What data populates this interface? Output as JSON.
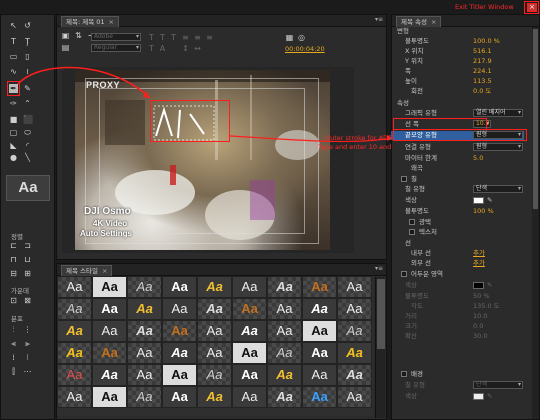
{
  "title_panel_tab": "제목: 제목 01",
  "title_props_tab": "제목 속성",
  "styles_tab": "제목 스타일",
  "annotation_close": "Exit Titler Window",
  "annotation_stroke_1": "Outer stroke for ADD",
  "annotation_stroke_2": "Type and enter 10 and choose Round",
  "toolbar": {
    "font_family": "Adobe",
    "font_style": "Regular",
    "timecode": "00:00:04:20"
  },
  "canvas": {
    "proxy_label": "PROXY",
    "overlay_line1": "DJI Osmo",
    "overlay_line2": "4K Video",
    "overlay_line3": "Auto Settings"
  },
  "props": {
    "transform_header": "변형",
    "opacity_label": "불투명도",
    "opacity_value": "100.0 %",
    "xpos_label": "X 위치",
    "xpos_value": "516.1",
    "ypos_label": "Y 위치",
    "ypos_value": "217.9",
    "width_label": "폭",
    "width_value": "224.1",
    "height_label": "높이",
    "height_value": "113.5",
    "rotation_label": "회전",
    "rotation_value": "0.0 도",
    "properties_header": "속성",
    "graphic_type_label": "그래픽 유형",
    "graphic_type_value": "열린 베지어",
    "line_width_label": "선 폭",
    "line_width_value": "10.0",
    "cap_type_label": "끝모양 유형",
    "cap_type_value": "원형",
    "join_type_label": "연결 유형",
    "join_type_value": "원형",
    "miter_label": "마이터 한계",
    "miter_value": "5.0",
    "distort_label": "왜곡",
    "fill_header": "칠",
    "fill_type_label": "칠 유형",
    "fill_type_value": "단색",
    "color_label": "색상",
    "fill_opacity_label": "불투명도",
    "fill_opacity_value": "100 %",
    "sheen_label": "광택",
    "texture_label": "텍스처",
    "stroke_header": "선",
    "inner_stroke_label": "내부 선",
    "inner_stroke_add": "추가",
    "outer_stroke_label": "외부 선",
    "outer_stroke_add": "추가",
    "shadow_header": "어두운 영역",
    "shadow_color_label": "색상",
    "shadow_opacity_label": "불투명도",
    "shadow_opacity_value": "50 %",
    "shadow_angle_label": "각도",
    "shadow_angle_value": "135.0 도",
    "shadow_distance_label": "거리",
    "shadow_distance_value": "10.0",
    "shadow_size_label": "크기",
    "shadow_size_value": "0.0",
    "shadow_spread_label": "확산",
    "shadow_spread_value": "30.0",
    "background_header": "배경",
    "bg_fill_type_label": "칠 유형",
    "bg_fill_type_value": "단색",
    "bg_color_label": "색상"
  },
  "left_panel": {
    "align_header": "정렬",
    "center_header": "가운데",
    "distribute_header": "분포"
  },
  "styles": [
    "Aa",
    "Aa",
    "Aa",
    "Aa",
    "Aa",
    "Aa",
    "Aa",
    "Aa",
    "Aa",
    "Aa",
    "Aa",
    "Aa",
    "Aa",
    "Aa",
    "Aa",
    "Aa",
    "Aa",
    "Aa",
    "Aa",
    "Aa",
    "Aa",
    "Aa",
    "Aa",
    "Aa",
    "Aa",
    "Aa",
    "Aa",
    "Aa",
    "Aa",
    "Aa",
    "Aa",
    "Aa",
    "Aa",
    "Aa",
    "Aa",
    "Aa",
    "Aa",
    "Aa",
    "Aa",
    "Aa",
    "Aa",
    "Aa",
    "Aa",
    "Aa",
    "Aa",
    "Aa",
    "Aa",
    "Aa",
    "Aa",
    "Aa",
    "Aa",
    "Aa",
    "Aa",
    "Aa",
    "Aa",
    "Aa",
    "Aa",
    "Aa",
    "Aa",
    "Aa"
  ],
  "colors": {
    "accent_value": "#e9a820",
    "annotation_red": "#ff1e1e",
    "highlight_blue": "#2f5f9e"
  }
}
